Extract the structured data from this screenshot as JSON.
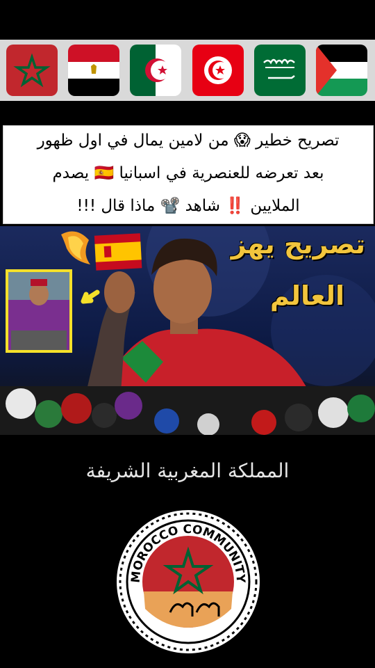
{
  "flags": [
    {
      "name": "morocco",
      "bg": "#c1272d",
      "symbol": "green-star"
    },
    {
      "name": "egypt",
      "colors": [
        "#ce1126",
        "#ffffff",
        "#000000"
      ]
    },
    {
      "name": "algeria",
      "colors": [
        "#006233",
        "#ffffff",
        "#d21034"
      ]
    },
    {
      "name": "tunisia",
      "bg": "#e70013"
    },
    {
      "name": "saudi-arabia",
      "bg": "#006c35"
    },
    {
      "name": "palestine",
      "colors": [
        "#000000",
        "#ffffff",
        "#149954",
        "#e4312b"
      ]
    }
  ],
  "headline": {
    "line1": "تصريح خطير 😱 من لامين يمال في اول ظهور",
    "line2": "بعد تعرضه للعنصرية في اسبانيا 🇪🇸 يصدم",
    "line3": "الملايين ‼️ شاهد 📽️ ماذا قال !!!"
  },
  "photo": {
    "overlay_line1": "تصريح يهز",
    "overlay_line2": "العالم"
  },
  "kingdom_title": "المملكة المغربية الشريفة",
  "badge": {
    "text": "MOROCCO COMMUNITY",
    "colors": {
      "flag_red": "#c1272d",
      "star_green": "#006233",
      "sand": "#e9a257"
    }
  },
  "colors": {
    "overlay_text": "#f2c53d",
    "strip_bg": "#d9d9d9"
  }
}
